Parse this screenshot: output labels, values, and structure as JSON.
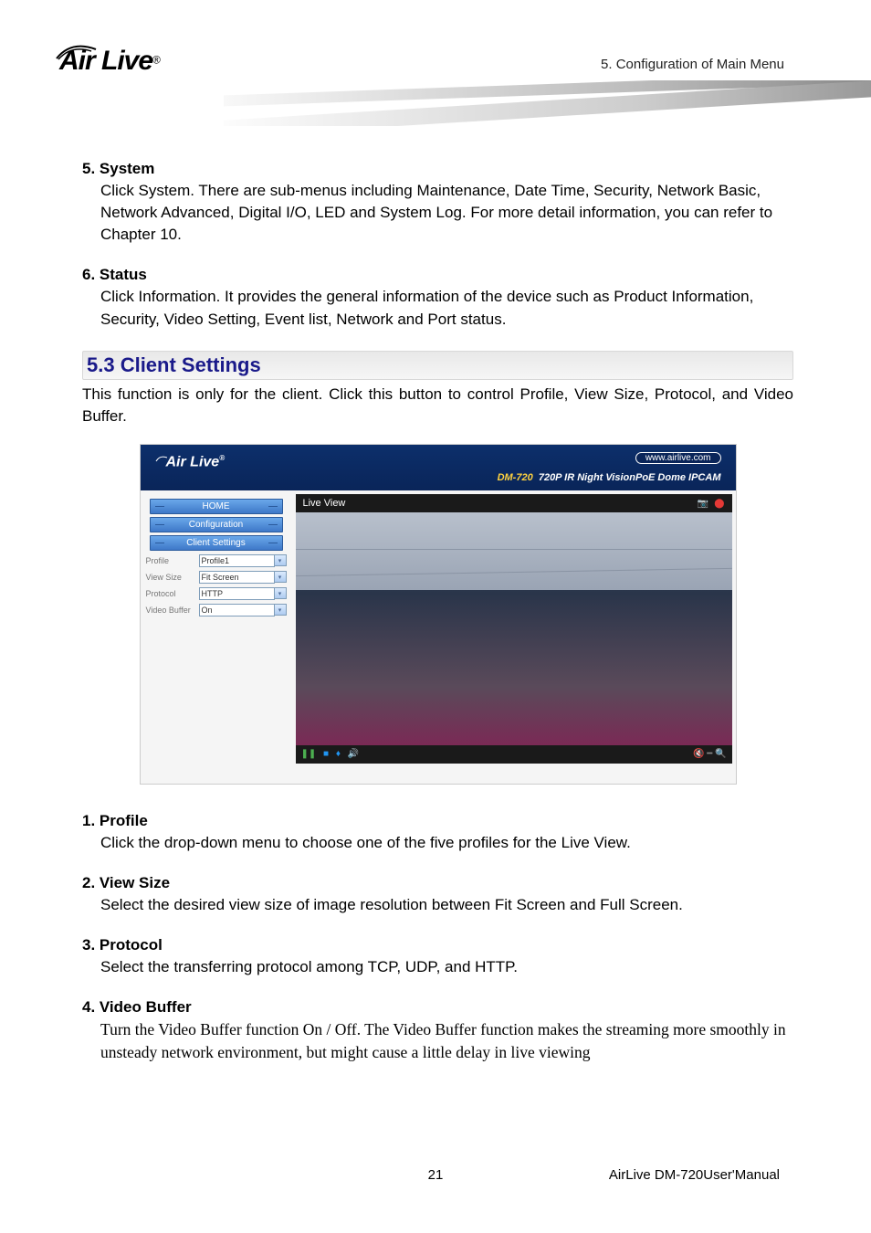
{
  "header": {
    "logo_text": "Air Live",
    "chapter": "5. Configuration of Main Menu"
  },
  "sections": {
    "system": {
      "title": "5.  System",
      "body": "Click System. There are sub-menus including Maintenance, Date Time, Security, Network Basic, Network Advanced, Digital I/O, LED and System Log. For more detail information, you can refer to Chapter 10."
    },
    "status": {
      "title": "6.  Status",
      "body": "Click Information. It provides the general information of the device such as Product Information, Security, Video Setting, Event list, Network and Port status."
    },
    "client_settings": {
      "heading": "5.3 Client Settings",
      "intro": "This function is only for the client. Click this button to control Profile, View Size, Protocol, and Video Buffer."
    },
    "profile": {
      "title": "1.  Profile",
      "body": "Click the drop-down menu to choose one of the five profiles for the Live View."
    },
    "viewsize": {
      "title": "2.  View Size",
      "body": "Select the desired view size of image resolution between Fit Screen and Full Screen."
    },
    "protocol": {
      "title": "3.  Protocol",
      "body": "Select the transferring protocol among TCP, UDP, and HTTP."
    },
    "videobuffer": {
      "title": "4.  Video Buffer",
      "body": "Turn the Video Buffer function On / Off. The Video Buffer function makes the streaming more smoothly in unsteady network environment, but might cause a little delay in live viewing"
    }
  },
  "screenshot": {
    "logo": "Air Live",
    "url": "www.airlive.com",
    "model": "DM-720",
    "model_desc": "720P IR Night VisionPoE Dome IPCAM",
    "nav": {
      "home": "HOME",
      "config": "Configuration",
      "client": "Client Settings"
    },
    "fields": {
      "profile_label": "Profile",
      "profile_value": "Profile1",
      "viewsize_label": "View Size",
      "viewsize_value": "Fit Screen",
      "protocol_label": "Protocol",
      "protocol_value": "HTTP",
      "buffer_label": "Video Buffer",
      "buffer_value": "On"
    },
    "main_title": "Live View"
  },
  "footer": {
    "page": "21",
    "manual": "AirLive DM-720User'Manual"
  }
}
